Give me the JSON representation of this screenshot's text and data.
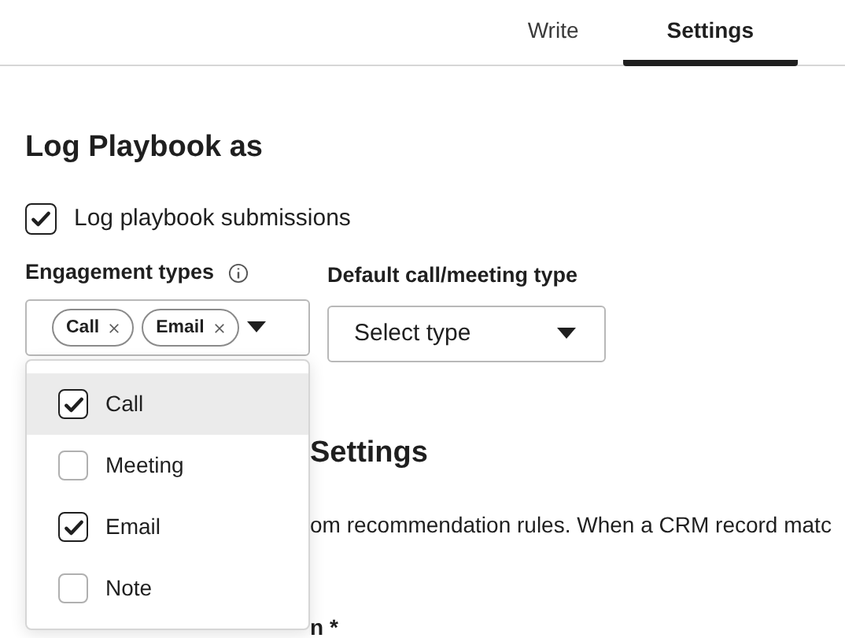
{
  "tabs": [
    {
      "label": "Write",
      "selected": false
    },
    {
      "label": "Settings",
      "selected": true
    }
  ],
  "log_section": {
    "heading": "Log Playbook as",
    "checkbox": {
      "label": "Log playbook submissions",
      "checked": true
    },
    "engagement_types": {
      "label": "Engagement types",
      "tags": [
        "Call",
        "Email"
      ]
    },
    "default_type": {
      "label": "Default call/meeting type",
      "placeholder": "Select type"
    }
  },
  "dropdown": {
    "options": [
      {
        "label": "Call",
        "checked": true,
        "highlighted": true
      },
      {
        "label": "Meeting",
        "checked": false,
        "highlighted": false
      },
      {
        "label": "Email",
        "checked": true,
        "highlighted": false
      },
      {
        "label": "Note",
        "checked": false,
        "highlighted": false
      }
    ]
  },
  "behind": {
    "heading": "Settings",
    "text": "om recommendation rules. When a CRM record matc",
    "label": "n *"
  }
}
